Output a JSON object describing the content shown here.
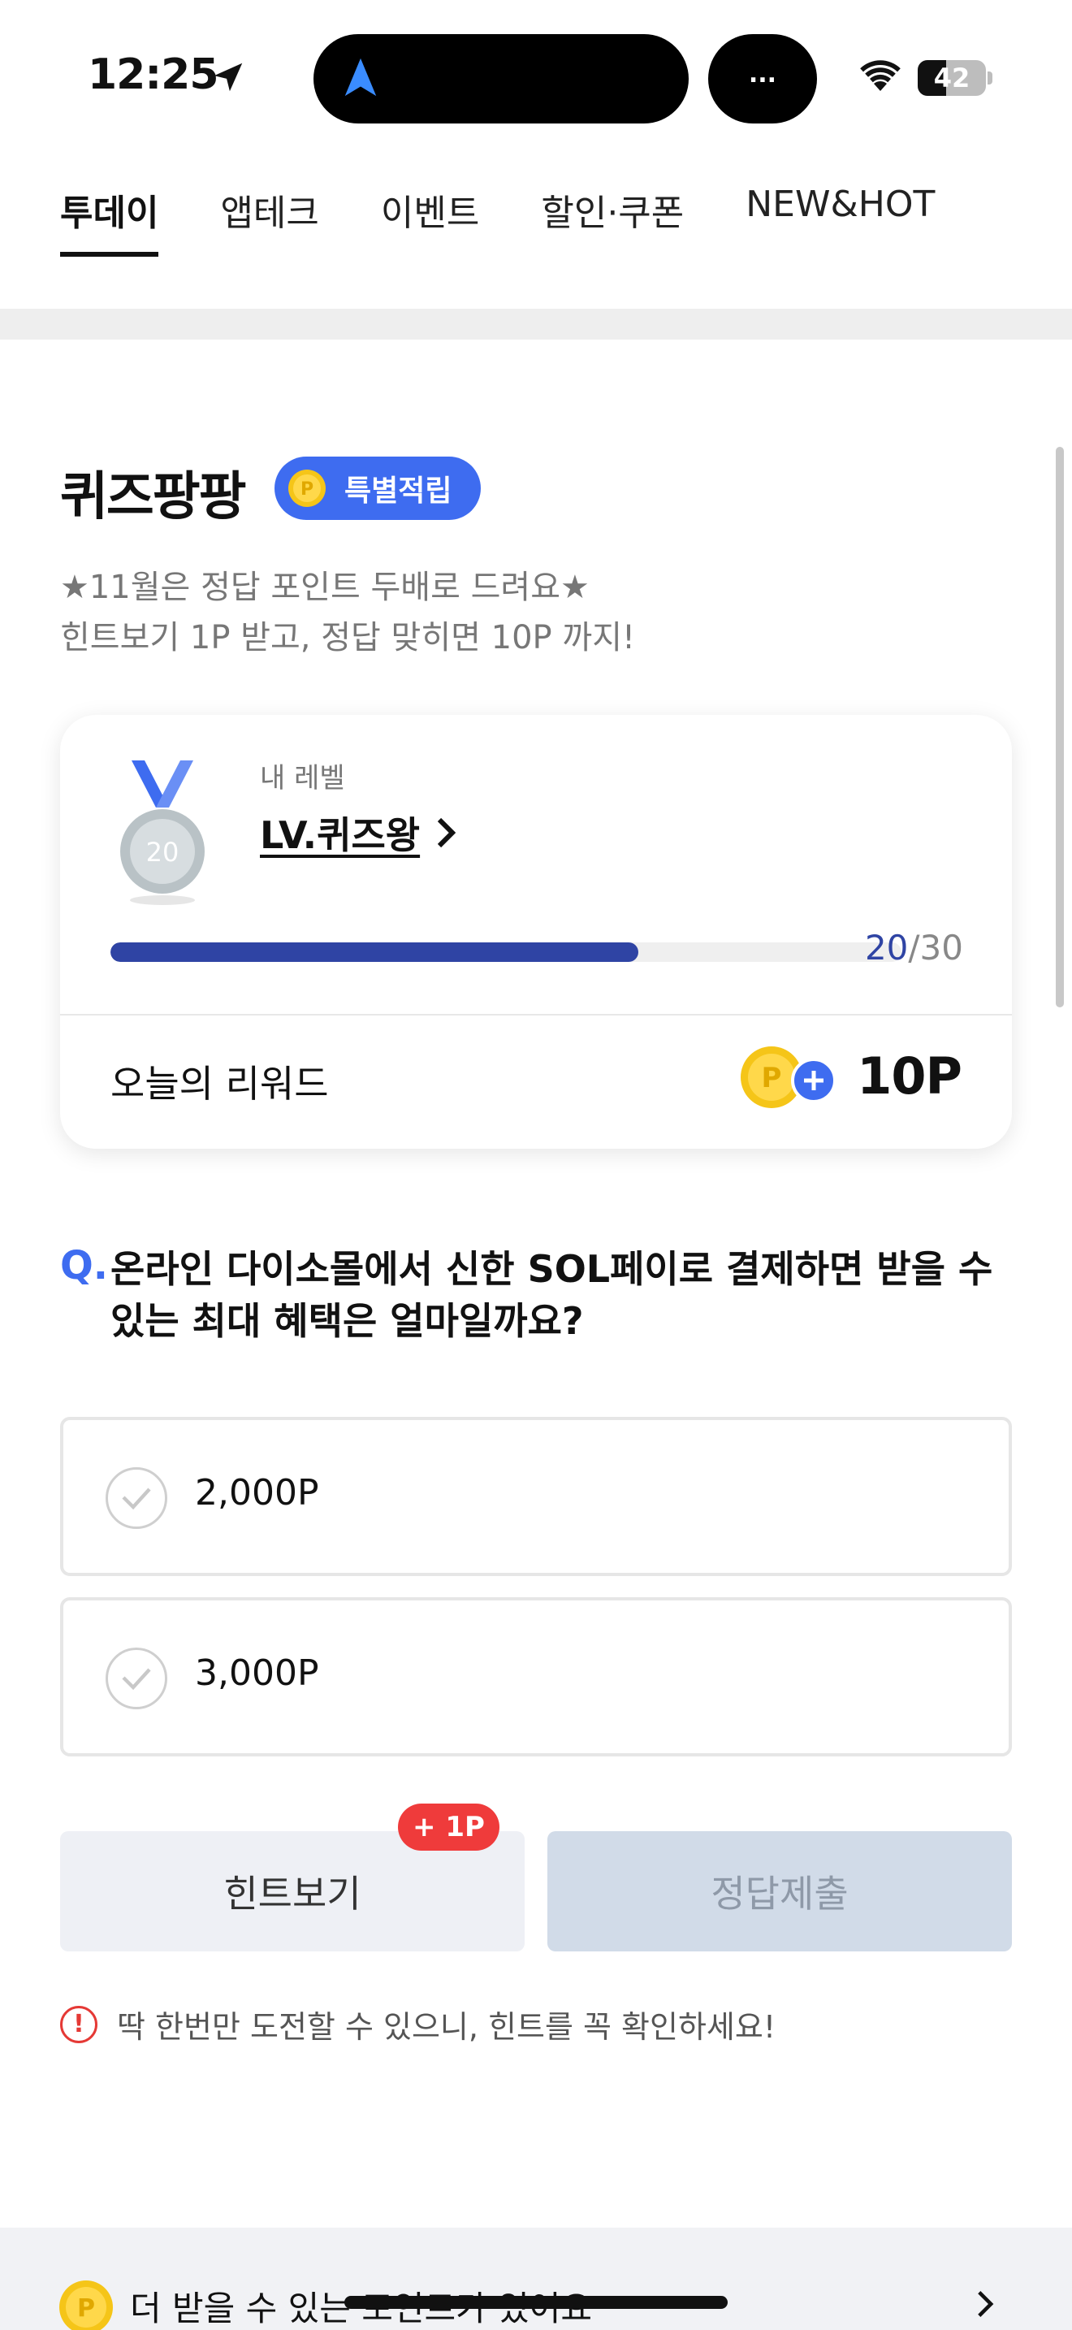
{
  "status_bar": {
    "time": "12:25",
    "island_more": "...",
    "battery_level": "42",
    "battery_fraction": 0.42
  },
  "tabs": [
    {
      "label": "투데이",
      "active": true
    },
    {
      "label": "앱테크",
      "active": false
    },
    {
      "label": "이벤트",
      "active": false
    },
    {
      "label": "할인·쿠폰",
      "active": false
    },
    {
      "label": "NEW&HOT",
      "active": false
    }
  ],
  "quiz": {
    "title": "퀴즈팡팡",
    "badge": "특별적립",
    "subtitle_line1": "★11월은 정답 포인트 두배로 드려요★",
    "subtitle_line2": "힌트보기 1P 받고, 정답 맞히면 10P 까지!"
  },
  "level_card": {
    "label": "내 레벨",
    "name": "LV.퀴즈왕",
    "medal_number": "20",
    "progress_current": "20",
    "progress_separator": "/",
    "progress_total": "30",
    "progress_fraction": 0.667,
    "reward_label": "오늘의 리워드",
    "reward_amount": "10P",
    "coin_letter": "P"
  },
  "question": {
    "mark": "Q.",
    "text": "온라인 다이소몰에서 신한 SOL페이로 결제하면 받을 수 있는 최대 혜택은 얼마일까요?",
    "options": [
      {
        "label": "2,000P"
      },
      {
        "label": "3,000P"
      }
    ]
  },
  "buttons": {
    "hint": "힌트보기",
    "hint_bonus": "+ 1P",
    "submit": "정답제출"
  },
  "notice": {
    "icon": "!",
    "text": "딱 한번만 도전할 수 있으니, 힌트를 꼭 확인하세요!"
  },
  "bottom_banner": {
    "text": "더 받을 수 있는 포인트가 있어요"
  },
  "colors": {
    "accent": "#3e6cf0",
    "progress": "#2f44a4",
    "badge_red": "#ef3b3b",
    "coin": "#f5c518"
  }
}
